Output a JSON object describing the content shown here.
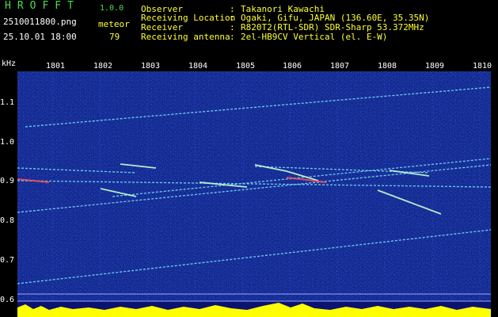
{
  "header": {
    "app_title": "HROFFT",
    "app_version": "1.0.0",
    "file_name": "2510011800.png",
    "date_time": "25.10.01 18:00",
    "meteor_label": "meteor",
    "meteor_count": "79"
  },
  "info": [
    {
      "label": "Observer",
      "sep": ":",
      "value": "Takanori Kawachi"
    },
    {
      "label": "Receiving Location",
      "sep": ":",
      "value": "Ogaki, Gifu, JAPAN (136.60E, 35.35N)"
    },
    {
      "label": "Receiver",
      "sep": ":",
      "value": "R820T2(RTL-SDR) SDR-Sharp 53.372MHz"
    },
    {
      "label": "Receiving antenna",
      "sep": ":",
      "value": "2el-HB9CV Vertical (el. E-W)"
    }
  ],
  "axes": {
    "y_unit": "kHz",
    "x_ticks": [
      "1801",
      "1802",
      "1803",
      "1804",
      "1805",
      "1806",
      "1807",
      "1808",
      "1809",
      "1810"
    ],
    "y_ticks": [
      "1.1",
      "1.0",
      "0.9",
      "0.8",
      "0.7",
      "0.6"
    ]
  },
  "colors": {
    "background": "#000000",
    "plot_noise": "#0a1a8a",
    "signal_cyan": "#7fe8ff",
    "signal_hot": "#ff5050",
    "strip": "#ffff00",
    "header_green": "#4ddc4d",
    "header_yellow": "#ffff33"
  }
}
